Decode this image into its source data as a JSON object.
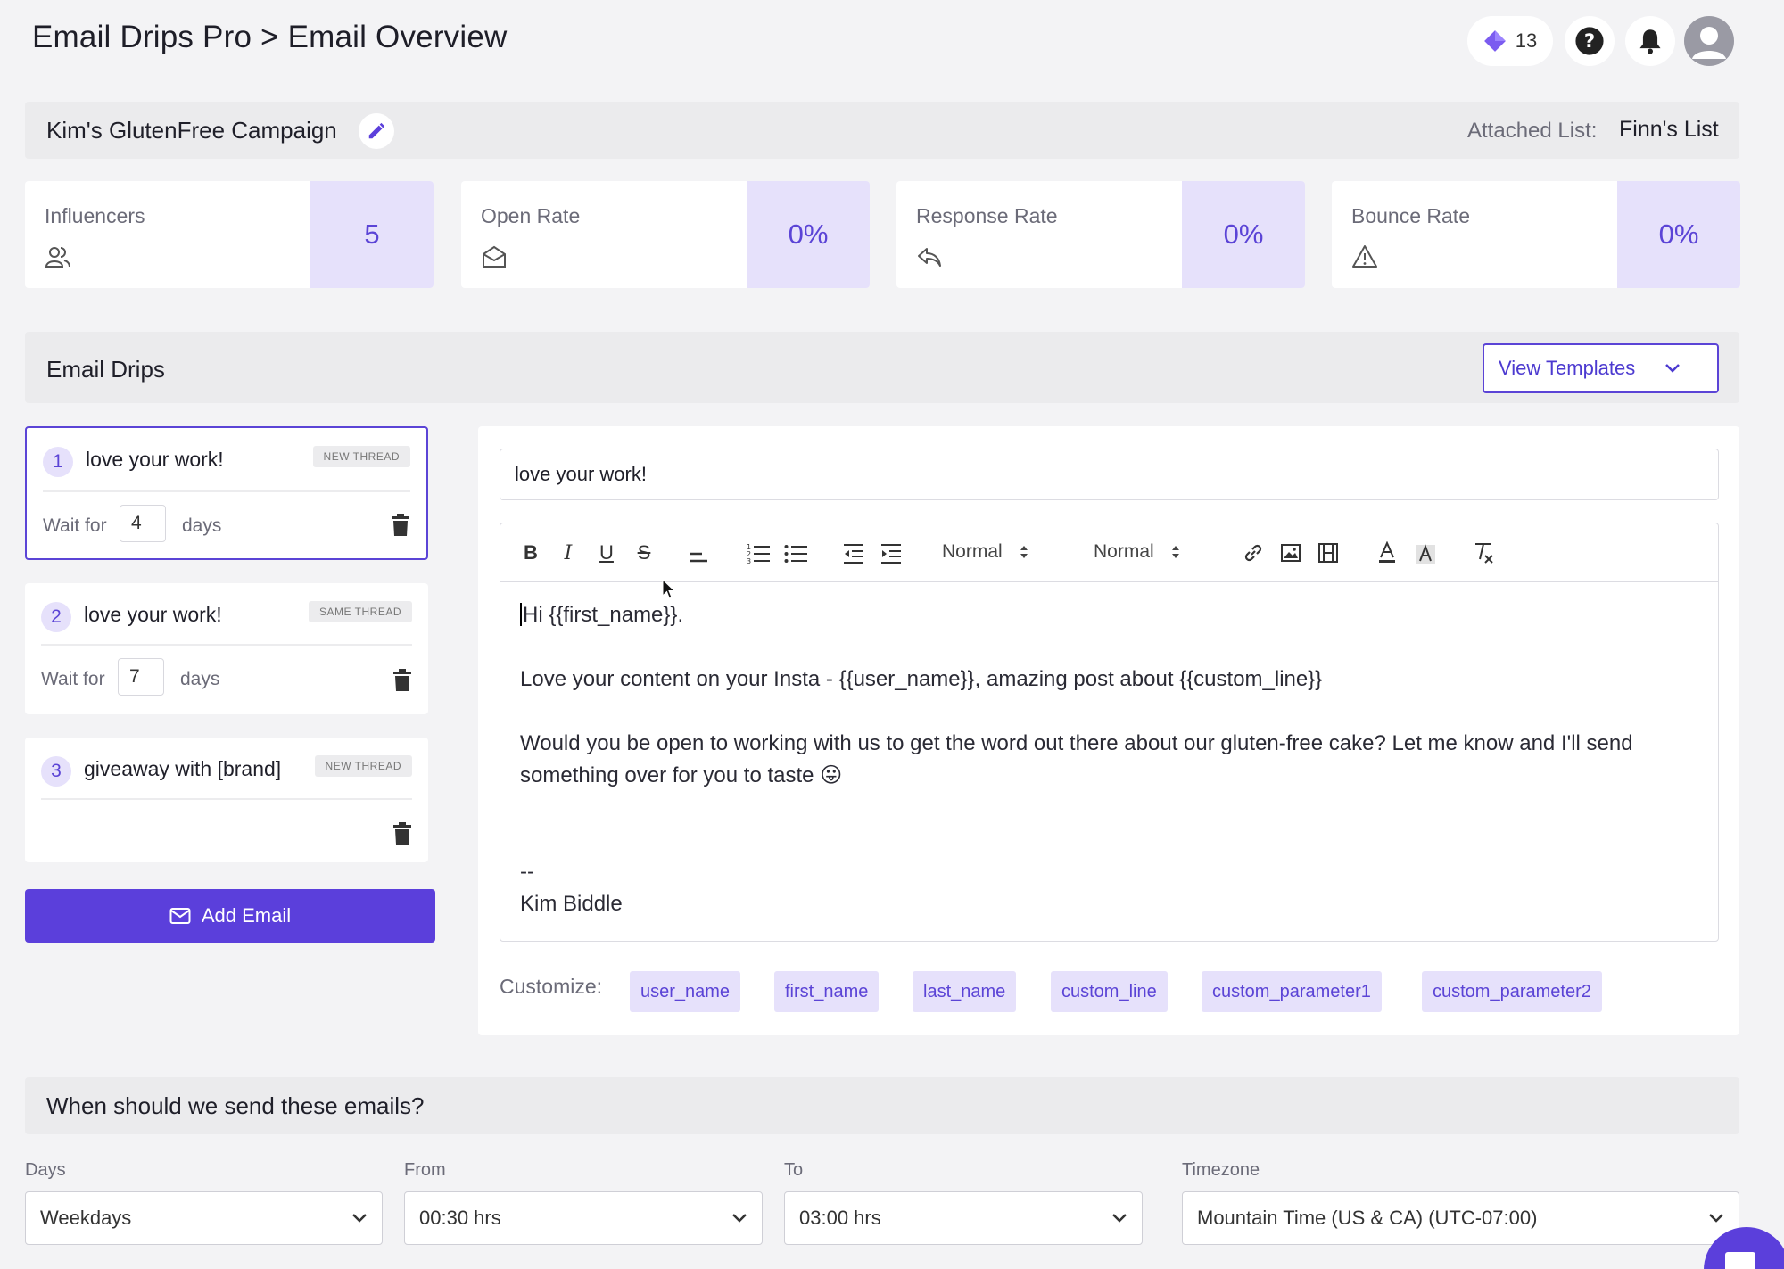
{
  "header": {
    "title": "Email Drips Pro > Email Overview",
    "credits": "13"
  },
  "campaign": {
    "name": "Kim's GlutenFree Campaign",
    "attached_label": "Attached List:",
    "attached_value": "Finn's List"
  },
  "stats": [
    {
      "label": "Influencers",
      "value": "5",
      "icon": "users-icon"
    },
    {
      "label": "Open Rate",
      "value": "0%",
      "icon": "envelope-open-icon"
    },
    {
      "label": "Response Rate",
      "value": "0%",
      "icon": "reply-icon"
    },
    {
      "label": "Bounce Rate",
      "value": "0%",
      "icon": "warning-icon"
    }
  ],
  "drips": {
    "title": "Email Drips",
    "view_templates": "View Templates",
    "items": [
      {
        "num": "1",
        "subject": "love your work!",
        "tag": "NEW THREAD",
        "wait_label": "Wait for",
        "wait": "4",
        "days_label": "days"
      },
      {
        "num": "2",
        "subject": "love your work!",
        "tag": "SAME THREAD",
        "wait_label": "Wait for",
        "wait": "7",
        "days_label": "days"
      },
      {
        "num": "3",
        "subject": "giveaway with [brand]",
        "tag": "NEW THREAD"
      }
    ],
    "add_email": "Add Email"
  },
  "editor": {
    "subject": "love your work!",
    "header_select": "Normal",
    "size_select": "Normal",
    "body": {
      "greeting": "Hi {{first_name}}.",
      "line1": "Love your content on your Insta - {{user_name}}, amazing post about {{custom_line}}",
      "line2": "Would you be open to working with us to get the word out there about our gluten-free cake? Let me know and I'll send something over for you to taste",
      "emoji": "😛",
      "sig_sep": "--",
      "signature": "Kim Biddle"
    },
    "customize_label": "Customize:",
    "chips": [
      "user_name",
      "first_name",
      "last_name",
      "custom_line",
      "custom_parameter1",
      "custom_parameter2"
    ]
  },
  "schedule": {
    "title": "When should we send these emails?",
    "days_label": "Days",
    "days_value": "Weekdays",
    "from_label": "From",
    "from_value": "00:30 hrs",
    "to_label": "To",
    "to_value": "03:00 hrs",
    "tz_label": "Timezone",
    "tz_value": "Mountain Time (US & CA) (UTC-07:00)"
  },
  "colors": {
    "accent": "#5b3fdb",
    "accent_light": "#e6e1fb",
    "background": "#f3f3f5"
  }
}
